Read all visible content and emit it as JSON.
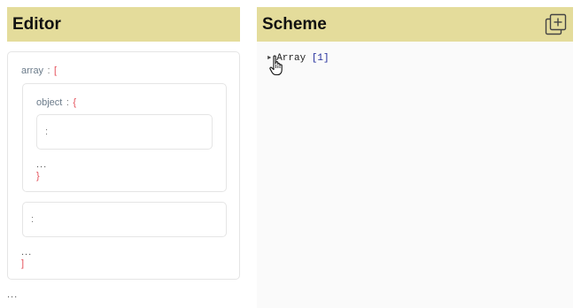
{
  "editor": {
    "title": "Editor",
    "root_key": "array",
    "colon": ":",
    "open_bracket": "[",
    "close_bracket": "]",
    "ellipsis": "...",
    "object_key": "object",
    "open_brace": "{",
    "close_brace": "}",
    "inner_field_colon": ":",
    "array_field_colon": ":",
    "object_ellipsis": "...",
    "array_ellipsis": "...",
    "bottom_ellipsis": "..."
  },
  "scheme": {
    "title": "Scheme",
    "icon": "add-copy-icon",
    "tree": {
      "label": "Array",
      "count": "[1]"
    }
  }
}
